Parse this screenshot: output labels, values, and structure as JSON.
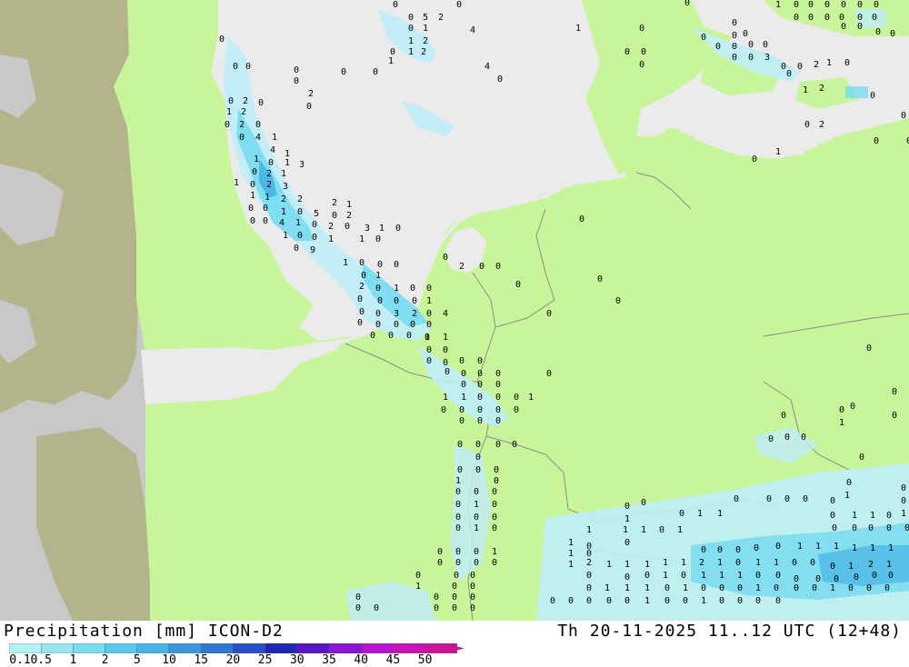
{
  "title": {
    "left_label": "Precipitation [mm] ICON-D2",
    "right_label": "Th 20-11-2025 11..12 UTC (12+48)"
  },
  "legend": {
    "labels": [
      "0.1",
      "0.5",
      "1",
      "2",
      "5",
      "10",
      "15",
      "20",
      "25",
      "30",
      "35",
      "40",
      "45",
      "50"
    ],
    "colors": [
      "#b4f0f0",
      "#96e6f0",
      "#78dcf0",
      "#5ac8eb",
      "#46b4e6",
      "#3c96dc",
      "#3278d2",
      "#2850c8",
      "#1e28b4",
      "#5a14c8",
      "#8c14d2",
      "#b414d2",
      "#c814b4",
      "#c81496"
    ]
  },
  "colors": {
    "land": "#c8f59a",
    "sea": "#ebebeb",
    "outside_domain": "#c8c8c8",
    "outside_land": "#b4b48c",
    "border": "#8c8c8c",
    "precip_light": "#bfeefa",
    "precip_mid": "#78dcf0",
    "precip_heavy": "#46b4e6"
  },
  "map_values": [
    {
      "v": "0"
    },
    {
      "v": "0"
    },
    {
      "v": "5"
    },
    {
      "v": "2"
    },
    {
      "v": "0"
    },
    {
      "v": "1"
    },
    {
      "v": "1"
    },
    {
      "v": "2"
    },
    {
      "v": "0"
    },
    {
      "v": "1"
    },
    {
      "v": "2"
    },
    {
      "v": "4"
    },
    {
      "v": "4"
    },
    {
      "v": "0"
    },
    {
      "v": "0"
    },
    {
      "v": "0"
    },
    {
      "v": "0"
    },
    {
      "v": "0"
    },
    {
      "v": "0"
    },
    {
      "v": "0"
    },
    {
      "v": "0"
    },
    {
      "v": "1"
    },
    {
      "v": "0"
    },
    {
      "v": "0"
    },
    {
      "v": "2"
    },
    {
      "v": "0"
    },
    {
      "v": "2"
    },
    {
      "v": "0"
    },
    {
      "v": "1"
    },
    {
      "v": "2"
    },
    {
      "v": "0"
    },
    {
      "v": "2"
    },
    {
      "v": "0"
    },
    {
      "v": "1"
    },
    {
      "v": "4"
    },
    {
      "v": "1"
    },
    {
      "v": "0"
    },
    {
      "v": "4"
    },
    {
      "v": "1"
    },
    {
      "v": "0"
    },
    {
      "v": "1"
    },
    {
      "v": "3"
    },
    {
      "v": "0"
    },
    {
      "v": "2"
    },
    {
      "v": "1"
    },
    {
      "v": "1"
    },
    {
      "v": "0"
    },
    {
      "v": "2"
    },
    {
      "v": "3"
    },
    {
      "v": "1"
    },
    {
      "v": "1"
    },
    {
      "v": "2"
    },
    {
      "v": "2"
    },
    {
      "v": "0"
    },
    {
      "v": "0"
    },
    {
      "v": "1"
    },
    {
      "v": "0"
    },
    {
      "v": "5"
    },
    {
      "v": "2"
    },
    {
      "v": "1"
    },
    {
      "v": "2"
    },
    {
      "v": "0"
    },
    {
      "v": "0"
    },
    {
      "v": "0"
    },
    {
      "v": "4"
    },
    {
      "v": "1"
    },
    {
      "v": "0"
    },
    {
      "v": "2"
    },
    {
      "v": "0"
    },
    {
      "v": "3"
    },
    {
      "v": "1"
    },
    {
      "v": "0"
    },
    {
      "v": "1"
    },
    {
      "v": "0"
    },
    {
      "v": "0"
    },
    {
      "v": "1"
    },
    {
      "v": "1"
    },
    {
      "v": "0"
    },
    {
      "v": "0"
    },
    {
      "v": "9"
    },
    {
      "v": "1"
    },
    {
      "v": "0"
    },
    {
      "v": "0"
    },
    {
      "v": "0"
    },
    {
      "v": "0"
    },
    {
      "v": "1"
    },
    {
      "v": "2"
    },
    {
      "v": "0"
    },
    {
      "v": "1"
    },
    {
      "v": "0"
    },
    {
      "v": "0"
    },
    {
      "v": "0"
    },
    {
      "v": "0"
    },
    {
      "v": "0"
    },
    {
      "v": "0"
    },
    {
      "v": "1"
    },
    {
      "v": "0"
    },
    {
      "v": "0"
    },
    {
      "v": "3"
    },
    {
      "v": "2"
    },
    {
      "v": "0"
    },
    {
      "v": "4"
    },
    {
      "v": "0"
    },
    {
      "v": "0"
    },
    {
      "v": "0"
    },
    {
      "v": "0"
    },
    {
      "v": "0"
    },
    {
      "v": "0"
    },
    {
      "v": "0"
    },
    {
      "v": "0"
    },
    {
      "v": "1"
    },
    {
      "v": "1"
    },
    {
      "v": "0"
    },
    {
      "v": "0"
    },
    {
      "v": "0"
    },
    {
      "v": "0"
    },
    {
      "v": "0"
    },
    {
      "v": "0"
    },
    {
      "v": "0"
    },
    {
      "v": "0"
    },
    {
      "v": "0"
    },
    {
      "v": "0"
    },
    {
      "v": "0"
    },
    {
      "v": "0"
    },
    {
      "v": "0"
    },
    {
      "v": "0"
    },
    {
      "v": "1"
    },
    {
      "v": "1"
    },
    {
      "v": "0"
    },
    {
      "v": "0"
    },
    {
      "v": "0"
    },
    {
      "v": "1"
    },
    {
      "v": "0"
    },
    {
      "v": "0"
    },
    {
      "v": "0"
    },
    {
      "v": "0"
    },
    {
      "v": "0"
    },
    {
      "v": "0"
    },
    {
      "v": "0"
    },
    {
      "v": "0"
    },
    {
      "v": "0"
    },
    {
      "v": "0"
    },
    {
      "v": "0"
    },
    {
      "v": "0"
    },
    {
      "v": "0"
    },
    {
      "v": "0"
    },
    {
      "v": "0"
    },
    {
      "v": "0"
    },
    {
      "v": "1"
    },
    {
      "v": "0"
    },
    {
      "v": "0"
    },
    {
      "v": "0"
    },
    {
      "v": "0"
    },
    {
      "v": "0"
    },
    {
      "v": "1"
    },
    {
      "v": "0"
    },
    {
      "v": "0"
    },
    {
      "v": "0"
    },
    {
      "v": "0"
    },
    {
      "v": "0"
    },
    {
      "v": "1"
    },
    {
      "v": "0"
    },
    {
      "v": "0"
    },
    {
      "v": "0"
    },
    {
      "v": "0"
    },
    {
      "v": "1"
    },
    {
      "v": "0"
    },
    {
      "v": "0"
    },
    {
      "v": "0"
    },
    {
      "v": "0"
    },
    {
      "v": "0"
    },
    {
      "v": "0"
    },
    {
      "v": "0"
    },
    {
      "v": "1"
    },
    {
      "v": "0"
    },
    {
      "v": "0"
    },
    {
      "v": "0"
    },
    {
      "v": "0"
    },
    {
      "v": "0"
    },
    {
      "v": "0"
    },
    {
      "v": "0"
    },
    {
      "v": "0"
    },
    {
      "v": "0"
    },
    {
      "v": "0"
    },
    {
      "v": "0"
    },
    {
      "v": "0"
    },
    {
      "v": "0"
    },
    {
      "v": "0"
    },
    {
      "v": "0"
    },
    {
      "v": "0"
    },
    {
      "v": "0"
    },
    {
      "v": "2"
    },
    {
      "v": "0"
    },
    {
      "v": "0"
    },
    {
      "v": "0"
    },
    {
      "v": "0"
    },
    {
      "v": "0"
    },
    {
      "v": "0"
    },
    {
      "v": "0"
    },
    {
      "v": "0"
    },
    {
      "v": "0"
    },
    {
      "v": "0"
    },
    {
      "v": "0"
    },
    {
      "v": "3"
    },
    {
      "v": "0"
    },
    {
      "v": "0"
    },
    {
      "v": "2"
    },
    {
      "v": "1"
    },
    {
      "v": "0"
    },
    {
      "v": "1"
    },
    {
      "v": "2"
    },
    {
      "v": "0"
    },
    {
      "v": "0"
    },
    {
      "v": "2"
    },
    {
      "v": "0"
    },
    {
      "v": "0"
    },
    {
      "v": "1"
    },
    {
      "v": "0"
    },
    {
      "v": "0"
    },
    {
      "v": "0"
    },
    {
      "v": "0"
    },
    {
      "v": "0"
    },
    {
      "v": "1"
    },
    {
      "v": "0"
    },
    {
      "v": "0"
    },
    {
      "v": "0"
    },
    {
      "v": "0"
    },
    {
      "v": "1"
    },
    {
      "v": "0"
    },
    {
      "v": "0"
    },
    {
      "v": "0"
    },
    {
      "v": "0"
    },
    {
      "v": "0"
    },
    {
      "v": "0"
    },
    {
      "v": "0"
    },
    {
      "v": "0"
    },
    {
      "v": "0"
    },
    {
      "v": "0"
    },
    {
      "v": "0"
    },
    {
      "v": "0"
    },
    {
      "v": "0"
    },
    {
      "v": "0"
    },
    {
      "v": "0"
    },
    {
      "v": "0"
    },
    {
      "v": "0"
    },
    {
      "v": "0"
    },
    {
      "v": "0"
    },
    {
      "v": "0"
    },
    {
      "v": "0"
    },
    {
      "v": "0"
    },
    {
      "v": "1"
    },
    {
      "v": "0"
    },
    {
      "v": "0"
    },
    {
      "v": "0"
    },
    {
      "v": "0"
    },
    {
      "v": "0"
    },
    {
      "v": "0"
    },
    {
      "v": "1"
    },
    {
      "v": "0"
    },
    {
      "v": "0"
    },
    {
      "v": "1"
    },
    {
      "v": "0"
    },
    {
      "v": "0"
    },
    {
      "v": "0"
    },
    {
      "v": "0"
    },
    {
      "v": "0"
    },
    {
      "v": "1"
    },
    {
      "v": "1"
    },
    {
      "v": "0"
    },
    {
      "v": "0"
    },
    {
      "v": "0"
    },
    {
      "v": "0"
    },
    {
      "v": "0"
    },
    {
      "v": "0"
    },
    {
      "v": "0"
    },
    {
      "v": "0"
    },
    {
      "v": "0"
    },
    {
      "v": "1"
    },
    {
      "v": "1"
    },
    {
      "v": "0"
    },
    {
      "v": "1"
    },
    {
      "v": "1"
    },
    {
      "v": "1"
    },
    {
      "v": "0"
    },
    {
      "v": "1"
    },
    {
      "v": "1"
    },
    {
      "v": "1"
    },
    {
      "v": "0"
    },
    {
      "v": "1"
    },
    {
      "v": "0"
    },
    {
      "v": "0"
    },
    {
      "v": "0"
    },
    {
      "v": "0"
    },
    {
      "v": "0"
    },
    {
      "v": "0"
    },
    {
      "v": "0"
    },
    {
      "v": "1"
    },
    {
      "v": "1"
    },
    {
      "v": "1"
    },
    {
      "v": "1"
    },
    {
      "v": "1"
    },
    {
      "v": "1"
    },
    {
      "v": "1"
    },
    {
      "v": "2"
    },
    {
      "v": "1"
    },
    {
      "v": "1"
    },
    {
      "v": "1"
    },
    {
      "v": "1"
    },
    {
      "v": "1"
    },
    {
      "v": "2"
    },
    {
      "v": "1"
    },
    {
      "v": "0"
    },
    {
      "v": "1"
    },
    {
      "v": "1"
    },
    {
      "v": "0"
    },
    {
      "v": "0"
    },
    {
      "v": "0"
    },
    {
      "v": "1"
    },
    {
      "v": "2"
    },
    {
      "v": "1"
    },
    {
      "v": "0"
    },
    {
      "v": "0"
    },
    {
      "v": "0"
    },
    {
      "v": "1"
    },
    {
      "v": "0"
    },
    {
      "v": "1"
    },
    {
      "v": "1"
    },
    {
      "v": "1"
    },
    {
      "v": "0"
    },
    {
      "v": "0"
    },
    {
      "v": "0"
    },
    {
      "v": "0"
    },
    {
      "v": "0"
    },
    {
      "v": "0"
    },
    {
      "v": "0"
    },
    {
      "v": "0"
    },
    {
      "v": "0"
    },
    {
      "v": "1"
    },
    {
      "v": "1"
    },
    {
      "v": "1"
    },
    {
      "v": "0"
    },
    {
      "v": "1"
    },
    {
      "v": "0"
    },
    {
      "v": "0"
    },
    {
      "v": "0"
    },
    {
      "v": "1"
    },
    {
      "v": "0"
    },
    {
      "v": "0"
    },
    {
      "v": "0"
    },
    {
      "v": "1"
    },
    {
      "v": "0"
    },
    {
      "v": "0"
    },
    {
      "v": "0"
    },
    {
      "v": "0"
    },
    {
      "v": "0"
    },
    {
      "v": "0"
    },
    {
      "v": "0"
    },
    {
      "v": "0"
    },
    {
      "v": "1"
    },
    {
      "v": "0"
    },
    {
      "v": "0"
    },
    {
      "v": "1"
    },
    {
      "v": "0"
    },
    {
      "v": "0"
    },
    {
      "v": "0"
    },
    {
      "v": "0"
    },
    {
      "v": "0"
    },
    {
      "v": "0"
    }
  ]
}
